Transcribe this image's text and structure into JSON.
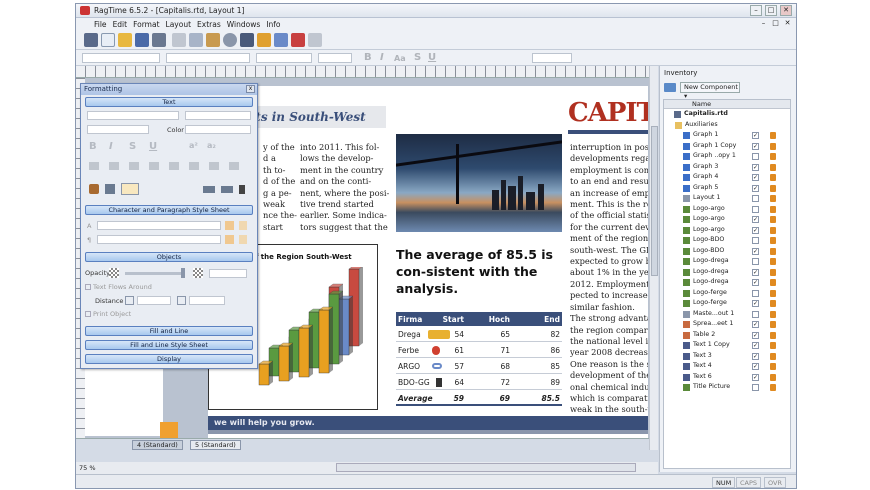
{
  "window": {
    "title": "RagTime 6.5.2 - [Capitalis.rtd, Layout 1]",
    "min": "–",
    "max": "□",
    "close": "✕"
  },
  "menu": [
    "File",
    "Edit",
    "Format",
    "Layout",
    "Extras",
    "Windows",
    "Info"
  ],
  "mdi": [
    "–",
    "□",
    "✕"
  ],
  "format_toolbar": {
    "bold": "B",
    "italic": "I",
    "aa": "Aa",
    "strike": "S",
    "underline": "U"
  },
  "formatting": {
    "title": "Formatting",
    "close": "x",
    "text_label": "Text",
    "color_label": "Color",
    "char_para_sheet": "Character and Paragraph Style Sheet",
    "a_label": "A",
    "para_label": "¶",
    "objects_label": "Objects",
    "opacity_label": "Opacity",
    "text_flows_around": "Text Flows Around",
    "distance_label": "Distance",
    "print_object": "Print Object",
    "fill_line": "Fill and Line",
    "fill_line_sheet": "Fill and Line Style Sheet",
    "display": "Display",
    "glyphs": [
      "B",
      "I",
      "S",
      "U",
      "a²",
      "a₂"
    ]
  },
  "document": {
    "headline": "rkets in South-West",
    "capital": "CAPITAL",
    "col1": "y of the\nd a\nth to-\nd of the\ng a pe-\nweak\nnce the-\nstart",
    "col2": "into 2011. This fol-\nlows the develop-\nment in the country\nand on the conti-\nnent, where the posi-\ntive trend started\nearlier. Some indica-\ntors suggest that the",
    "col3": "interruption in positi\ndevelopments regar\nemployment is comi\nto an end and result\nan increase of emplo\nment. This is the res\nof the official statisti\nfor the current devel\nment of the region\nsouth-west. The GDP\nexpected to grow by\nabout 1% in the year\n2012. Employment is\npected to increase in\nsimilar fashion.\nThe strong advantag\nthe region compared\nthe national level in\nyear 2008 decreased\nOne reason is the st\ndevelopment of the r\nonal chemical indust\nwhich is comparative\nweak in the south-w",
    "callout": "The average of 85.5 is con-sistent with the analysis.",
    "table": {
      "headers": [
        "Firma",
        "Start",
        "Hoch",
        "End"
      ],
      "rows": [
        [
          "Dregа",
          "54",
          "65",
          "82"
        ],
        [
          "Ferbe",
          "61",
          "71",
          "86"
        ],
        [
          "ARGO",
          "57",
          "68",
          "85"
        ],
        [
          "BDO-GG",
          "64",
          "72",
          "89"
        ]
      ],
      "total": [
        "Average",
        "59",
        "69",
        "85.5"
      ]
    },
    "chart_title": "ent of the Region South-West",
    "footer": "we will help you grow."
  },
  "page_tabs": [
    "4 (Standard)",
    "5 (Standard)"
  ],
  "zoom": "75 %",
  "status": [
    "NUM",
    "CAPS",
    "OVR"
  ],
  "inventory": {
    "title": "Inventory",
    "new_component": "New Component",
    "col_name": "Name",
    "root": "Capitalis.rtd",
    "items": [
      {
        "name": "Auxiliaries",
        "checked": false,
        "kind": "folder"
      },
      {
        "name": "Graph 1",
        "checked": true,
        "kind": "graph"
      },
      {
        "name": "Graph 1 Copy",
        "checked": true,
        "kind": "graph"
      },
      {
        "name": "Graph ..opy 1",
        "checked": false,
        "kind": "graph"
      },
      {
        "name": "Graph 3",
        "checked": true,
        "kind": "graph"
      },
      {
        "name": "Graph 4",
        "checked": true,
        "kind": "graph"
      },
      {
        "name": "Graph 5",
        "checked": true,
        "kind": "graph"
      },
      {
        "name": "Layout 1",
        "checked": false,
        "kind": "layout"
      },
      {
        "name": "Logo-argo",
        "checked": false,
        "kind": "pic"
      },
      {
        "name": "Logo-argo",
        "checked": true,
        "kind": "pic"
      },
      {
        "name": "Logo-argo",
        "checked": true,
        "kind": "pic"
      },
      {
        "name": "Logo-BDO",
        "checked": false,
        "kind": "pic"
      },
      {
        "name": "Logo-BDO",
        "checked": true,
        "kind": "pic"
      },
      {
        "name": "Logo-drega",
        "checked": false,
        "kind": "pic"
      },
      {
        "name": "Logo-drega",
        "checked": true,
        "kind": "pic"
      },
      {
        "name": "Logo-drega",
        "checked": true,
        "kind": "pic"
      },
      {
        "name": "Logo-ferge",
        "checked": false,
        "kind": "pic"
      },
      {
        "name": "Logo-ferge",
        "checked": true,
        "kind": "pic"
      },
      {
        "name": "Maste...out 1",
        "checked": false,
        "kind": "layout"
      },
      {
        "name": "Sprea...eet 1",
        "checked": true,
        "kind": "sheet"
      },
      {
        "name": "Table 2",
        "checked": true,
        "kind": "sheet"
      },
      {
        "name": "Text 1 Copy",
        "checked": true,
        "kind": "text"
      },
      {
        "name": "Text 3",
        "checked": true,
        "kind": "text"
      },
      {
        "name": "Text 4",
        "checked": true,
        "kind": "text"
      },
      {
        "name": "Text 6",
        "checked": true,
        "kind": "text"
      },
      {
        "name": "Title Picture",
        "checked": false,
        "kind": "pic"
      }
    ]
  },
  "colors": {
    "accent": "#3a4f7a",
    "capital": "#b03020",
    "graph": "#3a6ec8",
    "pic": "#5a8a3a",
    "lock": "#e08a20"
  },
  "chart_data": {
    "type": "bar",
    "title": "ent of the Region South-West",
    "series": [
      {
        "name": "",
        "values": [
          3,
          5,
          7,
          9
        ]
      },
      {
        "name": "",
        "values": [
          4,
          6,
          8,
          10
        ]
      },
      {
        "name": "",
        "values": [
          2,
          4,
          6,
          8
        ]
      },
      {
        "name": "",
        "values": [
          3,
          5,
          9,
          11
        ]
      }
    ]
  }
}
